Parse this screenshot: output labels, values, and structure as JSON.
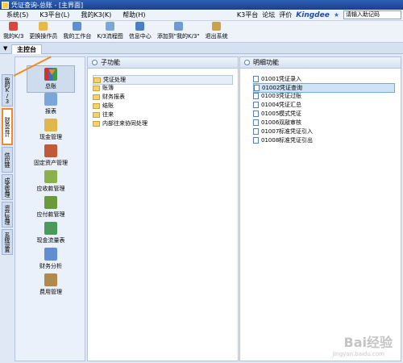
{
  "window": {
    "title": "凭证查询-总账 - [主界面]"
  },
  "menu": {
    "items": [
      "系统(S)",
      "K3平台(L)",
      "我的K3(K)",
      "帮助(H)"
    ],
    "links": [
      "K3平台",
      "论坛",
      "评价"
    ],
    "brand": "Kingdee",
    "help_placeholder": "请输入助记码"
  },
  "toolbar": {
    "buttons": [
      "我的K/3",
      "更换操作员",
      "我的工作台",
      "K/3流程图",
      "信息中心",
      "添加到\"我的K/3\"",
      "退出系统"
    ]
  },
  "tab": {
    "label": "主控台"
  },
  "side_tabs": [
    "我的K/3",
    "财务会计",
    "供应链",
    "成本管理",
    "资产管理",
    "系统设置"
  ],
  "modules": [
    "总账",
    "报表",
    "现金管理",
    "固定资产管理",
    "应收款管理",
    "应付款管理",
    "现金流量表",
    "财务分析",
    "费用管理"
  ],
  "sub_panel": {
    "title": "子功能",
    "items": [
      "凭证处理",
      "账簿",
      "财务报表",
      "结账",
      "往来",
      "内部往来协同处理"
    ]
  },
  "detail_panel": {
    "title": "明细功能",
    "items": [
      {
        "code": "01001",
        "name": "凭证录入"
      },
      {
        "code": "01002",
        "name": "凭证查询"
      },
      {
        "code": "01003",
        "name": "凭证过账"
      },
      {
        "code": "01004",
        "name": "凭证汇总"
      },
      {
        "code": "01005",
        "name": "模式凭证"
      },
      {
        "code": "01006",
        "name": "双敲审核"
      },
      {
        "code": "01007",
        "name": "标准凭证引入"
      },
      {
        "code": "01008",
        "name": "标准凭证引出"
      }
    ]
  },
  "watermark": {
    "main": "Bai经验",
    "sub": "jingyan.baidu.com"
  },
  "colors": {
    "accent": "#f08a24",
    "titlebar": "#1d3f8c",
    "selection": "#cfe3f7"
  }
}
